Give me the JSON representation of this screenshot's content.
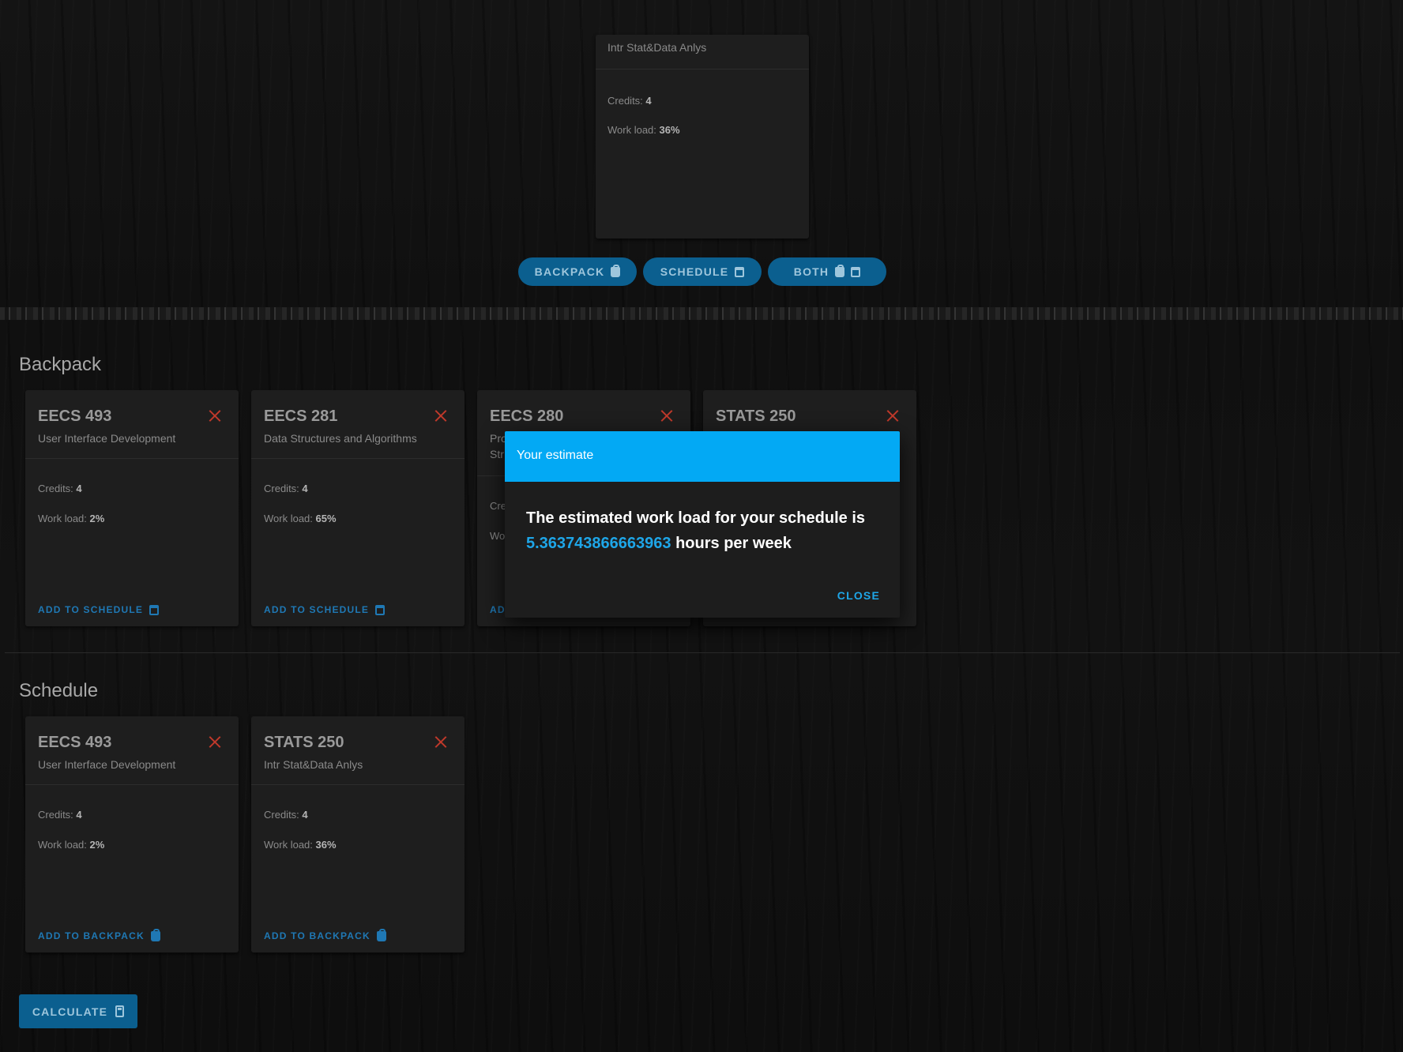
{
  "top_card": {
    "title": "Intr Stat&Data Anlys",
    "credits_label": "Credits:",
    "credits": "4",
    "workload_label": "Work load:",
    "workload": "36%"
  },
  "toolbar": {
    "backpack_label": "BACKPACK",
    "schedule_label": "SCHEDULE",
    "both_label": "BOTH"
  },
  "backpack": {
    "heading": "Backpack",
    "cards": [
      {
        "code": "EECS 493",
        "title": "User Interface Development",
        "credits": "4",
        "workload": "2%",
        "action": "ADD TO SCHEDULE"
      },
      {
        "code": "EECS 281",
        "title": "Data Structures and Algorithms",
        "credits": "4",
        "workload": "65%",
        "action": "ADD TO SCHEDULE"
      },
      {
        "code": "EECS 280",
        "title": "Pro",
        "title2": "Str",
        "credits_partial": "Cre",
        "workload_partial": "Wo",
        "action_partial": "AD"
      },
      {
        "code": "STATS 250"
      }
    ]
  },
  "schedule": {
    "heading": "Schedule",
    "cards": [
      {
        "code": "EECS 493",
        "title": "User Interface Development",
        "credits": "4",
        "workload": "2%",
        "action": "ADD TO BACKPACK"
      },
      {
        "code": "STATS 250",
        "title": "Intr Stat&Data Anlys",
        "credits": "4",
        "workload": "36%",
        "action": "ADD TO BACKPACK"
      }
    ]
  },
  "labels": {
    "credits": "Credits:",
    "workload": "Work load:"
  },
  "calculate_label": "CALCULATE",
  "dialog": {
    "title": "Your estimate",
    "text_before": "The estimated work load for your schedule is",
    "value": "5.363743866663963",
    "text_after": "hours per week",
    "close_label": "CLOSE"
  },
  "colors": {
    "accent": "#03a9f4",
    "button": "#0b5f8f",
    "remove": "#c0392b"
  }
}
